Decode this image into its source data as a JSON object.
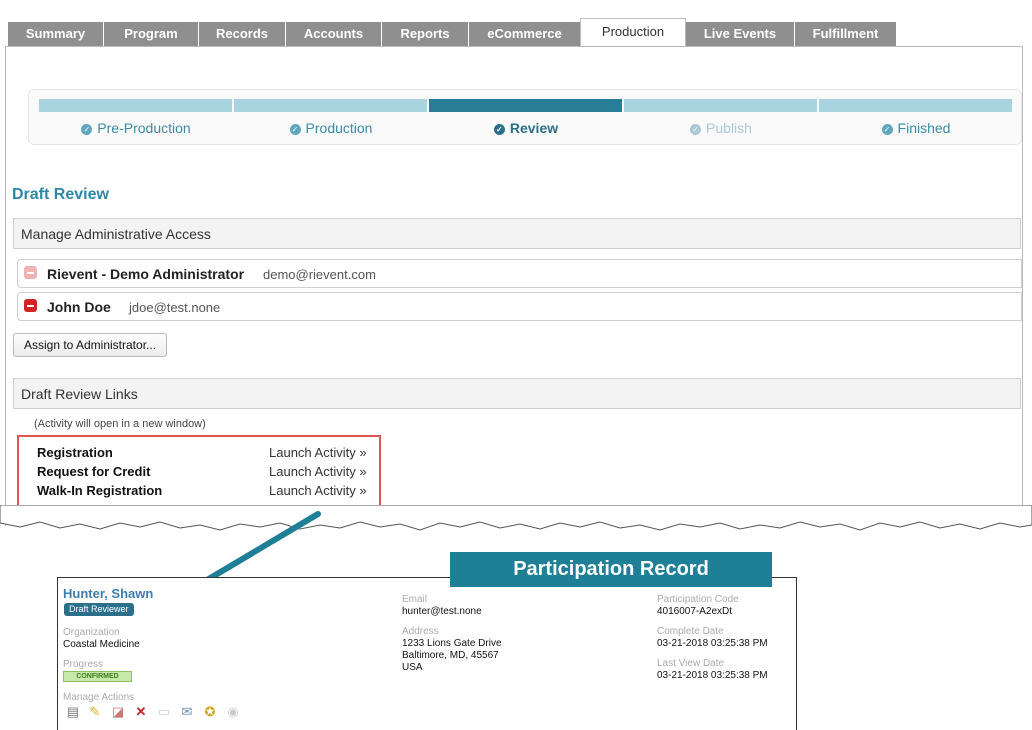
{
  "tabs": [
    {
      "label": "Summary"
    },
    {
      "label": "Program"
    },
    {
      "label": "Records"
    },
    {
      "label": "Accounts"
    },
    {
      "label": "Reports"
    },
    {
      "label": "eCommerce"
    },
    {
      "label": "Production"
    },
    {
      "label": "Live Events"
    },
    {
      "label": "Fulfillment"
    }
  ],
  "wizard": {
    "steps": [
      {
        "label": "Pre-Production"
      },
      {
        "label": "Production"
      },
      {
        "label": "Review"
      },
      {
        "label": "Publish"
      },
      {
        "label": "Finished"
      }
    ]
  },
  "page_title": "Draft Review",
  "admin_panel": {
    "title": "Manage Administrative Access",
    "admins": [
      {
        "name": "Rievent - Demo Administrator",
        "email": "demo@rievent.com"
      },
      {
        "name": "John Doe",
        "email": "jdoe@test.none"
      }
    ],
    "assign_button": "Assign to Administrator..."
  },
  "links_panel": {
    "title": "Draft Review Links",
    "note": "(Activity will open in a new window)",
    "links": [
      {
        "name": "Registration",
        "action": "Launch Activity »"
      },
      {
        "name": "Request for Credit",
        "action": "Launch Activity »"
      },
      {
        "name": "Walk-In Registration",
        "action": "Launch Activity »"
      }
    ]
  },
  "record": {
    "title": "Participation Record",
    "name": "Hunter, Shawn",
    "badge": "Draft Reviewer",
    "organization_label": "Organization",
    "organization": "Coastal Medicine",
    "progress_label": "Progress",
    "progress": "CONFIRMED",
    "manage_label": "Manage Actions",
    "email_label": "Email",
    "email": "hunter@test.none",
    "address_label": "Address",
    "address_line1": "1233 Lions Gate Drive",
    "address_line2": "Baltimore, MD, 45567",
    "address_line3": "USA",
    "code_label": "Participation Code",
    "code": "4016007-A2exDt",
    "complete_label": "Complete Date",
    "complete": "03-21-2018 03:25:38 PM",
    "lastview_label": "Last View Date",
    "lastview": "03-21-2018 03:25:38 PM"
  },
  "colors": {
    "accent": "#2a7d96",
    "tab_bg": "#8f8f8f",
    "highlight_border": "#e05555",
    "callout": "#1e7f96"
  }
}
